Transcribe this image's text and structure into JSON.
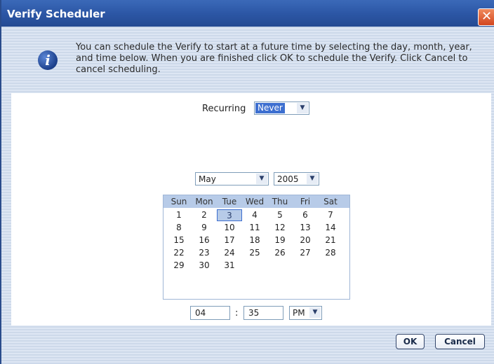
{
  "window": {
    "title": "Verify Scheduler",
    "close_symbol": "✕"
  },
  "message": "You can schedule the Verify to start at a future time by selecting the day, month, year, and time below.  When you are finished click OK to schedule the Verify.  Click Cancel to cancel scheduling.",
  "recurring": {
    "label": "Recurring",
    "value": "Never"
  },
  "month_select": {
    "value": "May"
  },
  "year_select": {
    "value": "2005"
  },
  "calendar": {
    "days_of_week": [
      "Sun",
      "Mon",
      "Tue",
      "Wed",
      "Thu",
      "Fri",
      "Sat"
    ],
    "weeks": [
      [
        "1",
        "2",
        "3",
        "4",
        "5",
        "6",
        "7"
      ],
      [
        "8",
        "9",
        "10",
        "11",
        "12",
        "13",
        "14"
      ],
      [
        "15",
        "16",
        "17",
        "18",
        "19",
        "20",
        "21"
      ],
      [
        "22",
        "23",
        "24",
        "25",
        "26",
        "27",
        "28"
      ],
      [
        "29",
        "30",
        "31",
        "",
        "",
        "",
        ""
      ]
    ],
    "selected_day": "3"
  },
  "time": {
    "hour": "04",
    "separator": ":",
    "minute": "35",
    "ampm": "PM"
  },
  "buttons": {
    "ok": "OK",
    "cancel": "Cancel"
  },
  "icons": {
    "info": "info-icon",
    "dropdown": "▼"
  }
}
